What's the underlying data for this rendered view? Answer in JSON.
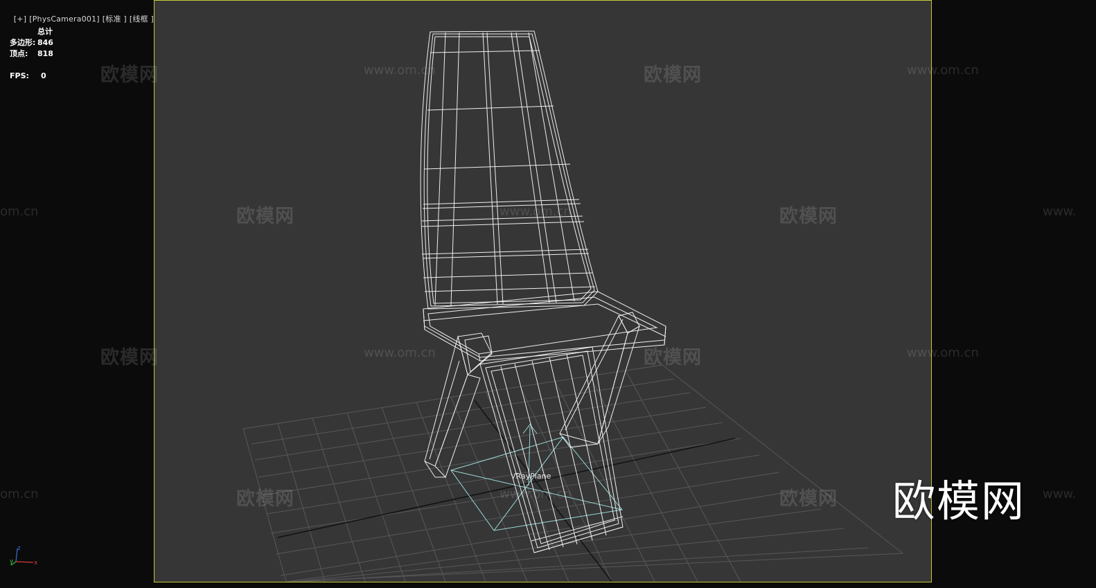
{
  "viewport": {
    "labels": [
      "[+]",
      "[PhysCamera001]",
      "[标准 ]",
      "[线框 ]"
    ]
  },
  "stats": {
    "header": "总计",
    "polygons_label": "多边形:",
    "polygons_value": "846",
    "vertices_label": "顶点:",
    "vertices_value": "818",
    "fps_label": "FPS:",
    "fps_value": "0"
  },
  "scene": {
    "object_label": "VRayPlane",
    "wireframe_color": "#ffffff",
    "grid_color": "#5a5a5a",
    "vray_plane_color": "#9ad8d8",
    "viewport_bg": "#363636",
    "frame_color": "#c8c83a"
  },
  "axis_gizmo": {
    "z": "z",
    "y": "y",
    "x": "x"
  },
  "watermark": {
    "logo": "欧模网",
    "url": "www.om.cn",
    "url_partial": "www.",
    "url_tail": "om.cn"
  }
}
